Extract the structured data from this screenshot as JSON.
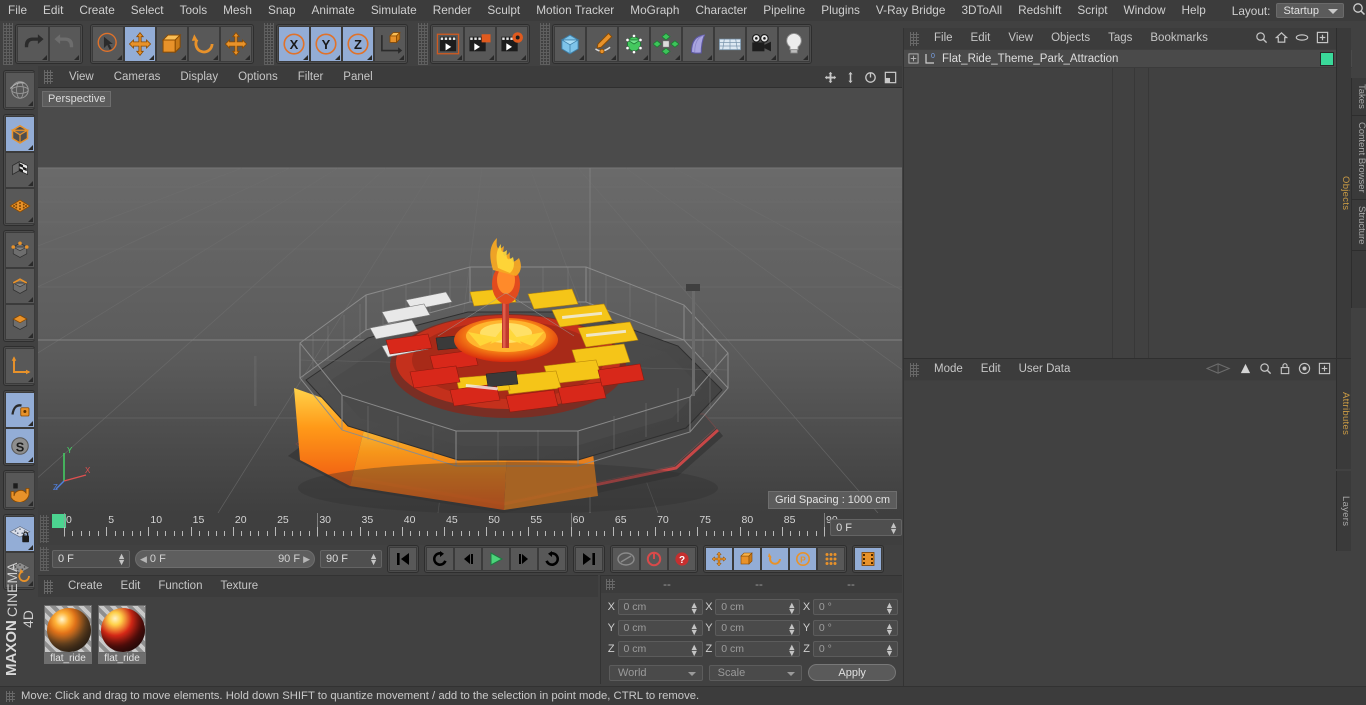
{
  "app": {
    "name": "MAXON CINEMA 4D",
    "logo_line1": "MAXON",
    "logo_line2": "CINEMA 4D"
  },
  "top_menu": {
    "items": [
      "File",
      "Edit",
      "Create",
      "Select",
      "Tools",
      "Mesh",
      "Snap",
      "Animate",
      "Simulate",
      "Render",
      "Sculpt",
      "Motion Tracker",
      "MoGraph",
      "Character",
      "Pipeline",
      "Plugins",
      "V-Ray Bridge",
      "3DToAll",
      "Redshift",
      "Script",
      "Window",
      "Help"
    ],
    "layout_label": "Layout:",
    "layout_value": "Startup",
    "search_icon": "search-icon"
  },
  "toolbar": {
    "groups": [
      {
        "name": "history",
        "buttons": [
          {
            "name": "undo-button",
            "icon": "undo-icon",
            "active": false
          },
          {
            "name": "redo-button",
            "icon": "redo-icon",
            "active": false
          }
        ]
      },
      {
        "name": "transform-tools",
        "buttons": [
          {
            "name": "live-selection-tool",
            "icon": "cursor-circle-icon",
            "active": false
          },
          {
            "name": "move-tool",
            "icon": "move-arrows-icon",
            "active": true
          },
          {
            "name": "scale-tool",
            "icon": "scale-box-icon",
            "active": false
          },
          {
            "name": "rotate-tool",
            "icon": "rotate-arc-icon",
            "active": false
          },
          {
            "name": "dynamic-place-tool",
            "icon": "move-arrows-icon",
            "active": false
          }
        ]
      },
      {
        "name": "axis-locks",
        "buttons": [
          {
            "name": "x-axis-lock",
            "icon": "x-circle-icon",
            "label": "X",
            "active": true
          },
          {
            "name": "y-axis-lock",
            "icon": "y-circle-icon",
            "label": "Y",
            "active": true
          },
          {
            "name": "z-axis-lock",
            "icon": "z-circle-icon",
            "label": "Z",
            "active": true
          },
          {
            "name": "world-object-axis-toggle",
            "icon": "world-axis-icon",
            "active": false
          }
        ]
      },
      {
        "name": "render-tools",
        "buttons": [
          {
            "name": "render-view-button",
            "icon": "render-view-icon",
            "active": false
          },
          {
            "name": "render-region-button",
            "icon": "render-region-icon",
            "active": false
          },
          {
            "name": "render-settings-button",
            "icon": "render-settings-icon",
            "active": false
          }
        ]
      },
      {
        "name": "create-objects",
        "buttons": [
          {
            "name": "add-cube-button",
            "icon": "cube-blue-icon",
            "active": false
          },
          {
            "name": "add-spline-button",
            "icon": "pen-spline-icon",
            "active": false
          },
          {
            "name": "add-generator-button",
            "icon": "green-cube-icon",
            "active": false
          },
          {
            "name": "add-mograph-button",
            "icon": "cloner-green-icon",
            "active": false
          },
          {
            "name": "add-deformer-button",
            "icon": "bend-purple-icon",
            "active": false
          },
          {
            "name": "add-environment-button",
            "icon": "floor-grid-icon",
            "active": false
          },
          {
            "name": "add-camera-button",
            "icon": "camera-icon",
            "active": false
          },
          {
            "name": "add-light-button",
            "icon": "light-bulb-icon",
            "active": false
          }
        ]
      }
    ]
  },
  "left_toolbar": {
    "groups": [
      {
        "buttons": [
          {
            "name": "undo-view-tool",
            "icon": "globe-wire-icon",
            "active": false
          }
        ]
      },
      {
        "buttons": [
          {
            "name": "model-mode-tool",
            "icon": "cube-orange-outline-icon",
            "active": true
          },
          {
            "name": "texture-mode-tool",
            "icon": "checker-cube-icon",
            "active": false
          },
          {
            "name": "workplane-tool",
            "icon": "orange-grid-plane-icon",
            "active": false
          }
        ]
      },
      {
        "buttons": [
          {
            "name": "points-mode-tool",
            "icon": "points-cube-icon",
            "active": false
          },
          {
            "name": "edges-mode-tool",
            "icon": "edges-cube-icon",
            "active": false
          },
          {
            "name": "polygons-mode-tool",
            "icon": "polygon-cube-icon",
            "active": false
          }
        ]
      },
      {
        "buttons": [
          {
            "name": "object-axis-tool",
            "icon": "axis-orange-icon",
            "active": false
          }
        ]
      },
      {
        "buttons": [
          {
            "name": "enable-axis-tool",
            "icon": "axis-lock-icon",
            "active": true
          },
          {
            "name": "soft-selection-tool",
            "icon": "soft-selection-s-icon",
            "active": true
          }
        ]
      },
      {
        "buttons": [
          {
            "name": "snap-magnet-tool",
            "icon": "magnet-icon",
            "active": false
          }
        ]
      },
      {
        "buttons": [
          {
            "name": "workplane-lock-tool",
            "icon": "grid-lock-icon",
            "active": true
          },
          {
            "name": "workplane-rotate-tool",
            "icon": "grid-rotate-icon",
            "active": false
          }
        ]
      }
    ]
  },
  "viewport": {
    "menu_items": [
      "View",
      "Cameras",
      "Display",
      "Options",
      "Filter",
      "Panel"
    ],
    "nav_icons": [
      "pan-icon",
      "dolly-icon",
      "orbit-icon",
      "maximize-icon"
    ],
    "label": "Perspective",
    "grid_spacing": "Grid Spacing : 1000 cm",
    "axis_labels": {
      "y": "Y",
      "x": "X",
      "z": "Z"
    },
    "scene_description": "3D rendered flat ride theme park attraction with orange and red carriages on circular platform"
  },
  "timeline": {
    "start": 0,
    "end": 90,
    "major_labels": [
      0,
      5,
      10,
      15,
      20,
      25,
      30,
      35,
      40,
      45,
      50,
      55,
      60,
      65,
      70,
      75,
      80,
      85,
      90
    ],
    "current_frame_field": "0 F",
    "playhead_frame": 0
  },
  "playback": {
    "current_frame": "0 F",
    "range_start": "0 F",
    "range_end": "90 F",
    "end_frame": "90 F",
    "buttons": [
      {
        "name": "go-to-start-button",
        "icon": "skip-start-icon"
      },
      {
        "name": "previous-keyframe-button",
        "icon": "prev-key-icon"
      },
      {
        "name": "step-back-button",
        "icon": "step-back-icon"
      },
      {
        "name": "play-button",
        "icon": "play-icon"
      },
      {
        "name": "step-forward-button",
        "icon": "step-forward-icon"
      },
      {
        "name": "next-keyframe-button",
        "icon": "next-key-icon"
      },
      {
        "name": "go-to-end-button",
        "icon": "skip-end-icon"
      }
    ],
    "record_buttons": [
      {
        "name": "record-active-objects-button",
        "icon": "key-grey-icon"
      },
      {
        "name": "autokeying-button",
        "icon": "red-circle-icon"
      },
      {
        "name": "keyframe-selection-button",
        "icon": "red-question-icon"
      }
    ],
    "key_toggles": [
      {
        "name": "position-key-toggle",
        "icon": "move-arrows-icon",
        "active": true
      },
      {
        "name": "scale-key-toggle",
        "icon": "scale-box-icon",
        "active": true
      },
      {
        "name": "rotation-key-toggle",
        "icon": "rotate-arc-icon",
        "active": true
      },
      {
        "name": "parameter-key-toggle",
        "icon": "p-circle-icon",
        "active": true
      },
      {
        "name": "point-level-animation-toggle",
        "icon": "dots-grid-icon",
        "active": false
      }
    ],
    "film_button": {
      "name": "timeline-mode-button",
      "icon": "film-strip-icon",
      "active": true
    }
  },
  "material_manager": {
    "menu_items": [
      "Create",
      "Edit",
      "Function",
      "Texture"
    ],
    "materials": [
      {
        "name": "flat_ride",
        "preview": "orange-stripe-sphere"
      },
      {
        "name": "flat_ride",
        "preview": "red-orange-pattern-sphere"
      }
    ]
  },
  "coordinates": {
    "headers": [
      "--",
      "--",
      "--"
    ],
    "rows": [
      {
        "axis": "X",
        "position": "0 cm",
        "size": "0 cm",
        "rotation": "0 °"
      },
      {
        "axis": "Y",
        "position": "0 cm",
        "size": "0 cm",
        "rotation": "0 °"
      },
      {
        "axis": "Z",
        "position": "0 cm",
        "size": "0 cm",
        "rotation": "0 °"
      }
    ],
    "coord_system": "World",
    "mode": "Scale",
    "apply_label": "Apply"
  },
  "object_manager": {
    "menu_items": [
      "File",
      "Edit",
      "View",
      "Objects",
      "Tags",
      "Bookmarks"
    ],
    "header_icons": [
      "search-icon",
      "home-icon",
      "ellipse-icon",
      "new-layer-icon"
    ],
    "objects": [
      {
        "name": "Flat_Ride_Theme_Park_Attraction",
        "layer_badge": "0",
        "tag_color": "#3ad99a",
        "expandable": true
      }
    ],
    "tab_label": "Objects"
  },
  "attribute_manager": {
    "menu_items": [
      "Mode",
      "Edit",
      "User Data"
    ],
    "header_icons": [
      "history-icon",
      "arrow-up-icon",
      "search-icon",
      "lock-icon",
      "target-icon",
      "new-icon"
    ],
    "tab_labels": [
      "Attributes",
      "Layers"
    ]
  },
  "right_tabs": [
    "Objects",
    "Takes",
    "Content Browser",
    "Structure"
  ],
  "status_bar": {
    "message": "Move: Click and drag to move elements. Hold down SHIFT to quantize movement / add to the selection in point mode, CTRL to remove."
  },
  "colors": {
    "accent_orange": "#e8922a",
    "active_blue": "#93add6",
    "panel_bg": "#414141",
    "menu_bg": "#3c3c3c",
    "viewport_bg": "#474747",
    "green_tag": "#3ad99a",
    "playhead_green": "#4cd490"
  }
}
